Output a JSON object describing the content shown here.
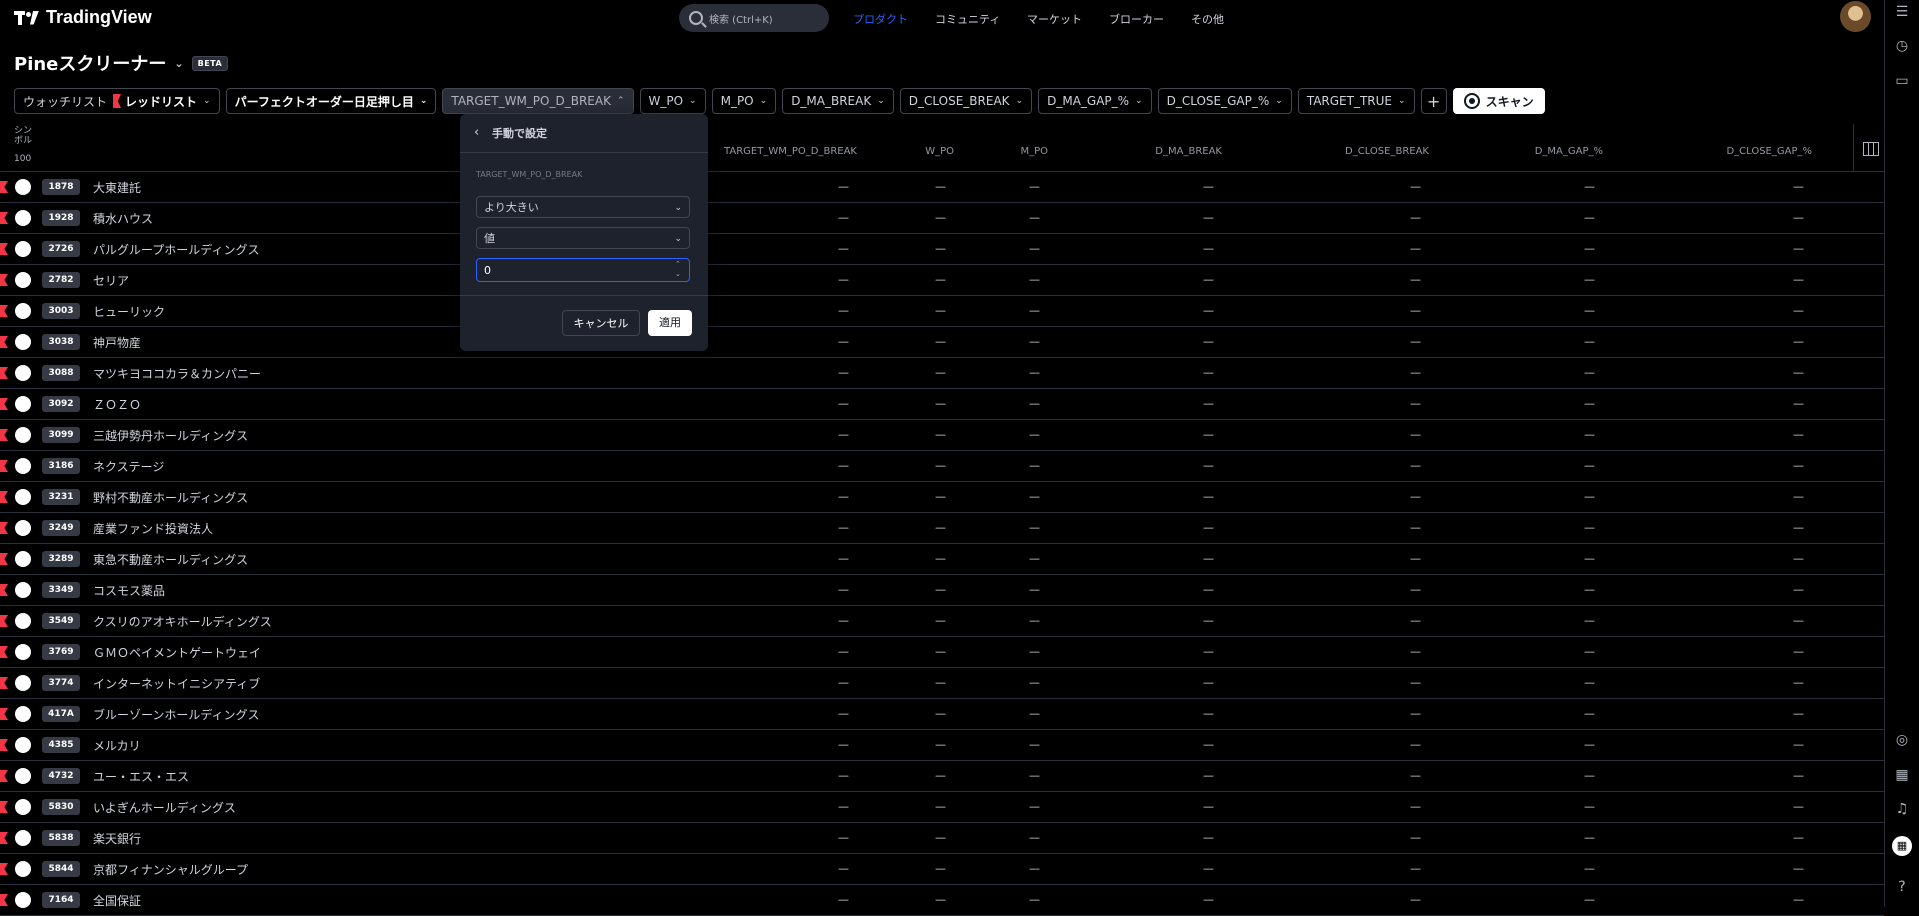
{
  "header": {
    "brand": "TradingView",
    "search_placeholder": "検索 (Ctrl+K)",
    "nav": [
      "プロダクト",
      "コミュニティ",
      "マーケット",
      "ブローカー",
      "その他"
    ]
  },
  "page": {
    "title": "Pineスクリーナー",
    "badge": "BETA"
  },
  "filters": {
    "watchlist_label": "ウォッチリスト",
    "watchlist_value": "レッドリスト",
    "script": "パーフェクトオーダー日足押し目",
    "chips": [
      "TARGET_WM_PO_D_BREAK",
      "W_PO",
      "M_PO",
      "D_MA_BREAK",
      "D_CLOSE_BREAK",
      "D_MA_GAP_%",
      "D_CLOSE_GAP_%",
      "TARGET_TRUE"
    ],
    "scan": "スキャン"
  },
  "table": {
    "symbol_header": "シンボル",
    "symbol_count": "100",
    "columns": [
      "TARGET_WM_PO_D_BREAK",
      "W_PO",
      "M_PO",
      "D_MA_BREAK",
      "D_CLOSE_BREAK",
      "D_MA_GAP_%",
      "D_CLOSE_GAP_%"
    ],
    "empty_value": "—",
    "rows": [
      {
        "code": "1878",
        "name": "大東建託"
      },
      {
        "code": "1928",
        "name": "積水ハウス"
      },
      {
        "code": "2726",
        "name": "パルグループホールディングス"
      },
      {
        "code": "2782",
        "name": "セリア"
      },
      {
        "code": "3003",
        "name": "ヒューリック"
      },
      {
        "code": "3038",
        "name": "神戸物産"
      },
      {
        "code": "3088",
        "name": "マツキヨココカラ＆カンパニー"
      },
      {
        "code": "3092",
        "name": "ＺＯＺＯ"
      },
      {
        "code": "3099",
        "name": "三越伊勢丹ホールディングス"
      },
      {
        "code": "3186",
        "name": "ネクステージ"
      },
      {
        "code": "3231",
        "name": "野村不動産ホールディングス"
      },
      {
        "code": "3249",
        "name": "産業ファンド投資法人"
      },
      {
        "code": "3289",
        "name": "東急不動産ホールディングス"
      },
      {
        "code": "3349",
        "name": "コスモス薬品"
      },
      {
        "code": "3549",
        "name": "クスリのアオキホールディングス"
      },
      {
        "code": "3769",
        "name": "ＧＭＯペイメントゲートウェイ"
      },
      {
        "code": "3774",
        "name": "インターネットイニシアティブ"
      },
      {
        "code": "417A",
        "name": "ブルーゾーンホールディングス"
      },
      {
        "code": "4385",
        "name": "メルカリ"
      },
      {
        "code": "4732",
        "name": "ユー・エス・エス"
      },
      {
        "code": "5830",
        "name": "いよぎんホールディングス"
      },
      {
        "code": "5838",
        "name": "楽天銀行"
      },
      {
        "code": "5844",
        "name": "京都フィナンシャルグループ"
      },
      {
        "code": "7164",
        "name": "全国保証"
      }
    ]
  },
  "popup": {
    "title": "手動で設定",
    "field_label": "TARGET_WM_PO_D_BREAK",
    "condition": "より大きい",
    "mode": "値",
    "value": "0",
    "cancel": "キャンセル",
    "apply": "適用"
  },
  "colors": {
    "accent": "#2962ff",
    "flag": "#f23645",
    "background": "#000000"
  }
}
